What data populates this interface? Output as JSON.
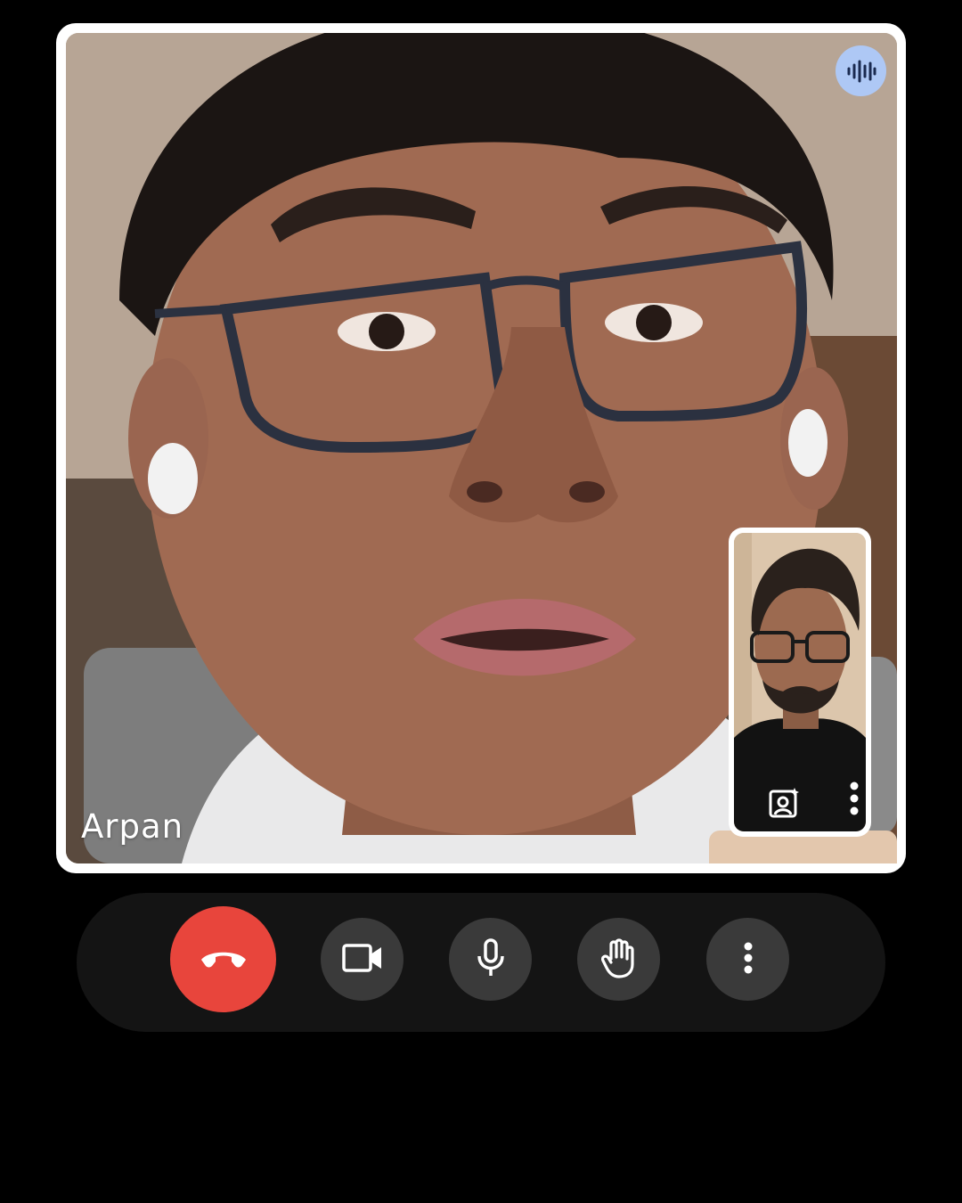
{
  "call": {
    "remote_participant_name": "Arpan",
    "remote_speaking_indicator": "audio-waveform-icon"
  },
  "self_view": {
    "effects_icon": "portrait-sparkle-icon",
    "more_icon": "more-vertical-icon"
  },
  "controls": [
    {
      "id": "end-call",
      "icon": "phone-hangup-icon",
      "color": "#e8453c"
    },
    {
      "id": "camera",
      "icon": "video-camera-icon"
    },
    {
      "id": "microphone",
      "icon": "microphone-icon"
    },
    {
      "id": "raise-hand",
      "icon": "hand-icon"
    },
    {
      "id": "more-options",
      "icon": "more-vertical-icon"
    }
  ],
  "colors": {
    "background": "#000000",
    "control_bar": "#141414",
    "control_button": "#3a3a3a",
    "end_call": "#e8453c",
    "speaking_badge": "#aec8f5",
    "icon": "#ffffff"
  }
}
